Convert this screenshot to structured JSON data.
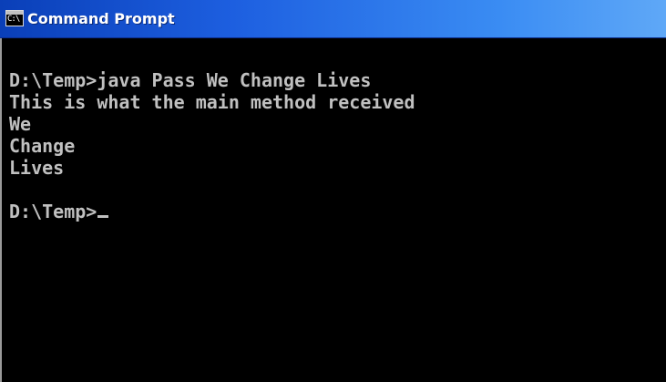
{
  "window": {
    "title": "Command Prompt",
    "icon": "command-prompt-icon",
    "icon_glyph": "C:\\"
  },
  "console": {
    "lines": [
      "",
      "D:\\Temp>java Pass We Change Lives",
      "This is what the main method received",
      "We",
      "Change",
      "Lives",
      "",
      "D:\\Temp>"
    ]
  },
  "colors": {
    "background": "#000000",
    "text": "#c0c0c0",
    "titlebar": "#1d5fe0"
  }
}
